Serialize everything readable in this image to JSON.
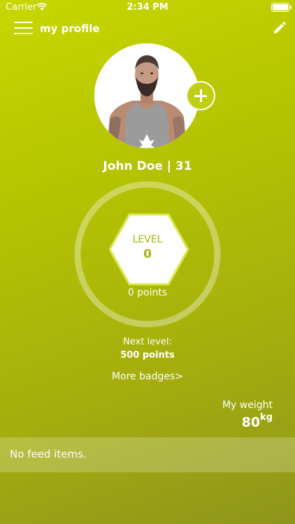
{
  "status_bar": {
    "carrier": "Carrier",
    "time": "2:34 PM"
  },
  "nav": {
    "title": "my profile",
    "menu_icon": "hamburger-menu-icon",
    "edit_icon": "pencil-icon"
  },
  "profile": {
    "name_age": "John Doe | 31",
    "add_photo_icon": "plus-icon"
  },
  "level": {
    "label": "LEVEL",
    "value": "0",
    "points": "0 points"
  },
  "next_level": {
    "label": "Next level:",
    "points": "500 points"
  },
  "badges_link": "More badges>",
  "weight": {
    "label": "My weight",
    "value": "80",
    "unit": "kg"
  },
  "feed": {
    "empty_text": "No feed items."
  },
  "colors": {
    "accent": "#c8d600",
    "level_text": "#a5b40a"
  }
}
